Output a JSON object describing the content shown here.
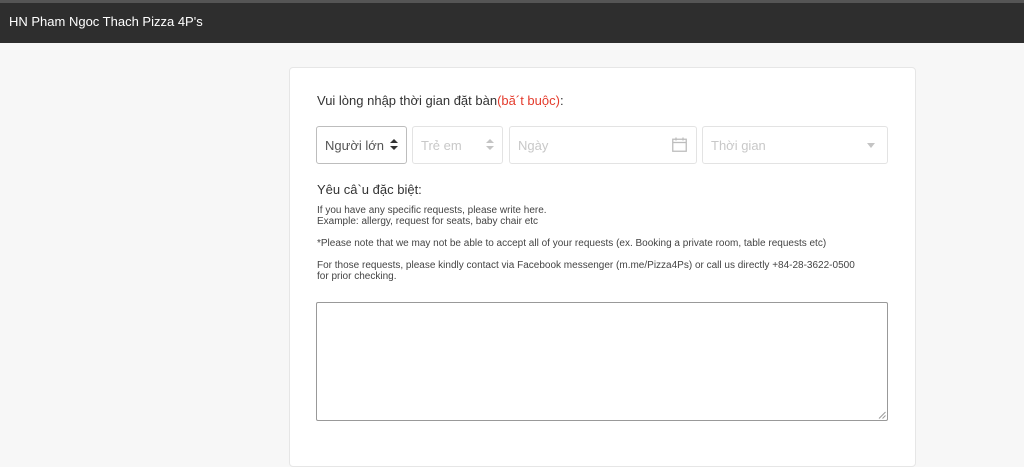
{
  "header": {
    "title": "HN Pham Ngoc Thach Pizza 4P's"
  },
  "form": {
    "prompt": "Vui lòng nhập thời gian đặt bàn",
    "required_note": "(bă´t buộc)",
    "prompt_colon": ":",
    "adults_label": "Người lớn",
    "children_label": "Trẻ em",
    "date_placeholder": "Ngày",
    "time_placeholder": "Thời gian",
    "special_label": "Yêu câ`u đặc biệt:",
    "notes": [
      "If you have any specific requests, please write here.",
      "Example: allergy, request for seats, baby chair etc",
      "*Please note that we may not be able to accept all of your requests (ex. Booking a private room, table requests etc)",
      "For those requests, please kindly contact via Facebook messenger (m.me/Pizza4Ps) or call us directly +84-28-3622-0500",
      "for prior checking."
    ],
    "textarea_value": ""
  },
  "colors": {
    "topbar": "#2e2e2e",
    "required": "#e43b2c"
  },
  "icons": {
    "calendar": "calendar-icon",
    "stepper": "stepper-arrows-icon",
    "dropdown": "chevron-down-icon",
    "resize": "resize-grip-icon"
  }
}
